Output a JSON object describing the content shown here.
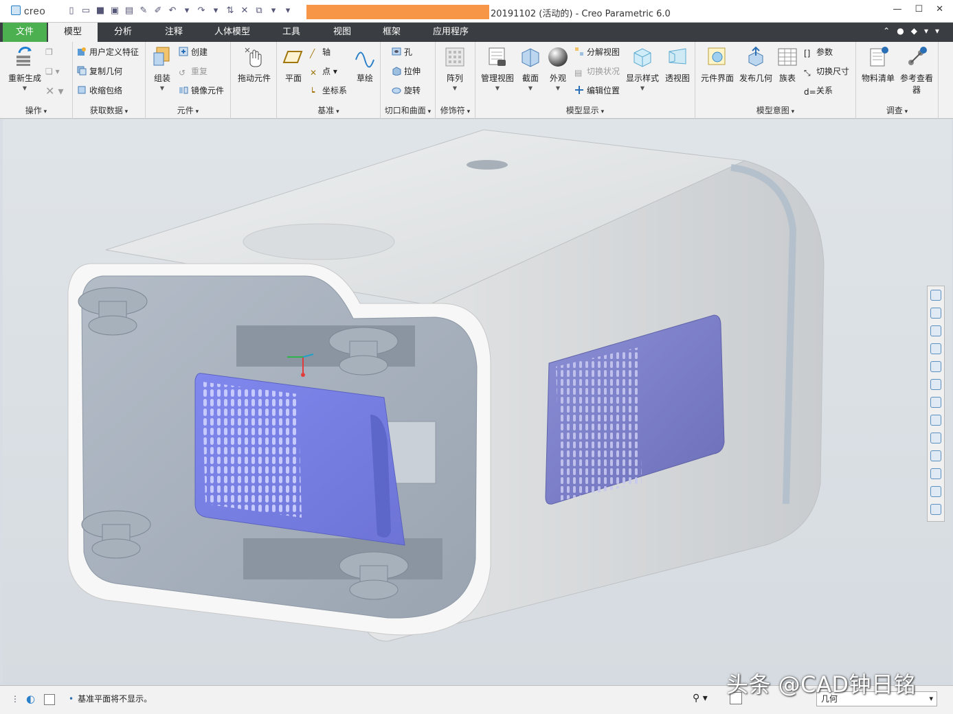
{
  "window": {
    "app_logo": "creo",
    "title": "20191102 (活动的) - Creo Parametric 6.0",
    "highlight_color": "#f79646"
  },
  "menu": {
    "file": "文件",
    "tabs": [
      "模型",
      "分析",
      "注释",
      "人体模型",
      "工具",
      "视图",
      "框架",
      "应用程序"
    ]
  },
  "ribbon": {
    "groups": {
      "operations": "操作",
      "get_data": "获取数据",
      "components": "元件",
      "datum": "基准",
      "cut_surface": "切口和曲面",
      "modifiers": "修饰符",
      "model_display": "模型显示",
      "model_intent": "模型意图",
      "investigate": "调查"
    },
    "regenerate": "重新生成",
    "user_defined_feature": "用户定义特征",
    "copy_geometry": "复制几何",
    "shrinkwrap": "收缩包络",
    "assemble": "组装",
    "create": "创建",
    "repeat": "重复",
    "mirror_component": "镜像元件",
    "drag_components": "拖动元件",
    "plane": "平面",
    "axis": "轴",
    "point": "点",
    "coord_sys": "坐标系",
    "sketch": "草绘",
    "hole": "孔",
    "extrude": "拉伸",
    "revolve": "旋转",
    "pattern": "阵列",
    "manage_views": "管理视图",
    "section": "截面",
    "appearance": "外观",
    "exploded_view": "分解视图",
    "toggle_status": "切换状况",
    "edit_position": "编辑位置",
    "display_style": "显示样式",
    "perspective_view": "透视图",
    "component_interface": "元件界面",
    "publish_geometry": "发布几何",
    "family_table": "族表",
    "parameters": "参数",
    "switch_dimensions": "切换尺寸",
    "relations": "关系",
    "bill_of_materials": "物料清单",
    "reference_viewer_1": "参考查看",
    "reference_viewer_2": "器"
  },
  "status": {
    "message": "基准平面将不显示。",
    "filter_value": "几何"
  },
  "watermark": "头条 @CAD钟日铭"
}
